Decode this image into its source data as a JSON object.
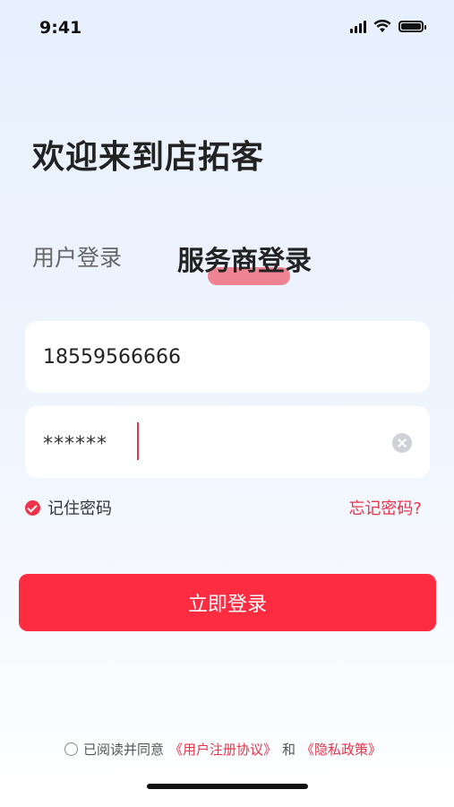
{
  "status_bar": {
    "time": "9:41",
    "icons": [
      "signal-icon",
      "wifi-icon",
      "battery-icon"
    ]
  },
  "welcome": "欢迎来到店拓客",
  "tabs": [
    {
      "label": "用户登录",
      "active": false
    },
    {
      "label": "服务商登录",
      "active": true
    }
  ],
  "form": {
    "phone_value": "18559566666",
    "password_value": "******"
  },
  "remember_label": "记住密码",
  "remember_checked": true,
  "forgot_label": "忘记密码?",
  "login_button": "立即登录",
  "agreement": {
    "prefix": "已阅读并同意",
    "user_agreement": "《用户注册协议》",
    "and": "和",
    "privacy": "《隐私政策》",
    "checked": false
  },
  "colors": {
    "accent": "#fd2c40",
    "link": "#e8334a"
  }
}
